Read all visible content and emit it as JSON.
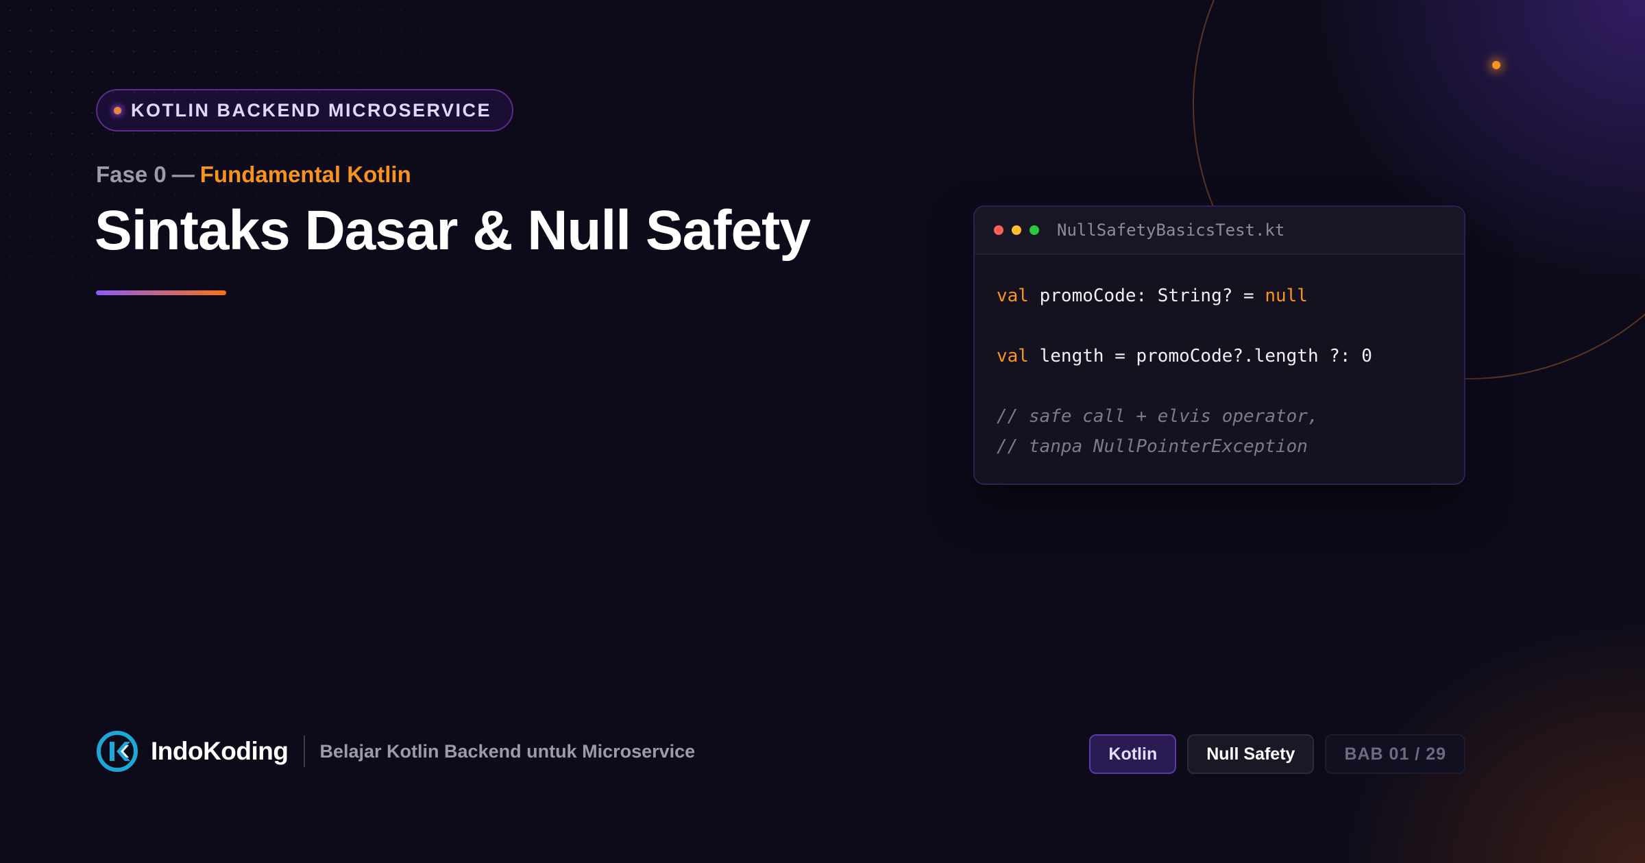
{
  "badge": {
    "label": "KOTLIN BACKEND MICROSERVICE"
  },
  "subtitle": {
    "phase": "Fase 0",
    "separator": "—",
    "topic": "Fundamental Kotlin"
  },
  "title": "Sintaks Dasar & Null Safety",
  "code_window": {
    "filename": "NullSafetyBasicsTest.kt",
    "lines": {
      "l1": {
        "kw": "val",
        "text": " promoCode: String? = ",
        "literal": "null"
      },
      "l2": {
        "kw": "val",
        "text": " length = promoCode?.length ?: 0"
      },
      "l3": {
        "comment": "// safe call + elvis operator,"
      },
      "l4": {
        "comment": "// tanpa NullPointerException"
      }
    }
  },
  "footer": {
    "brand_name": "IndoKoding",
    "tagline": "Belajar Kotlin Backend untuk Microservice",
    "chips": {
      "primary": "Kotlin",
      "secondary": "Null Safety",
      "chapter": "BAB 01 / 29"
    }
  },
  "colors": {
    "background": "#0d0b1a",
    "accent_orange": "#f7931e",
    "accent_purple": "#8b5cf6",
    "logo_blue": "#1ea7d6"
  }
}
